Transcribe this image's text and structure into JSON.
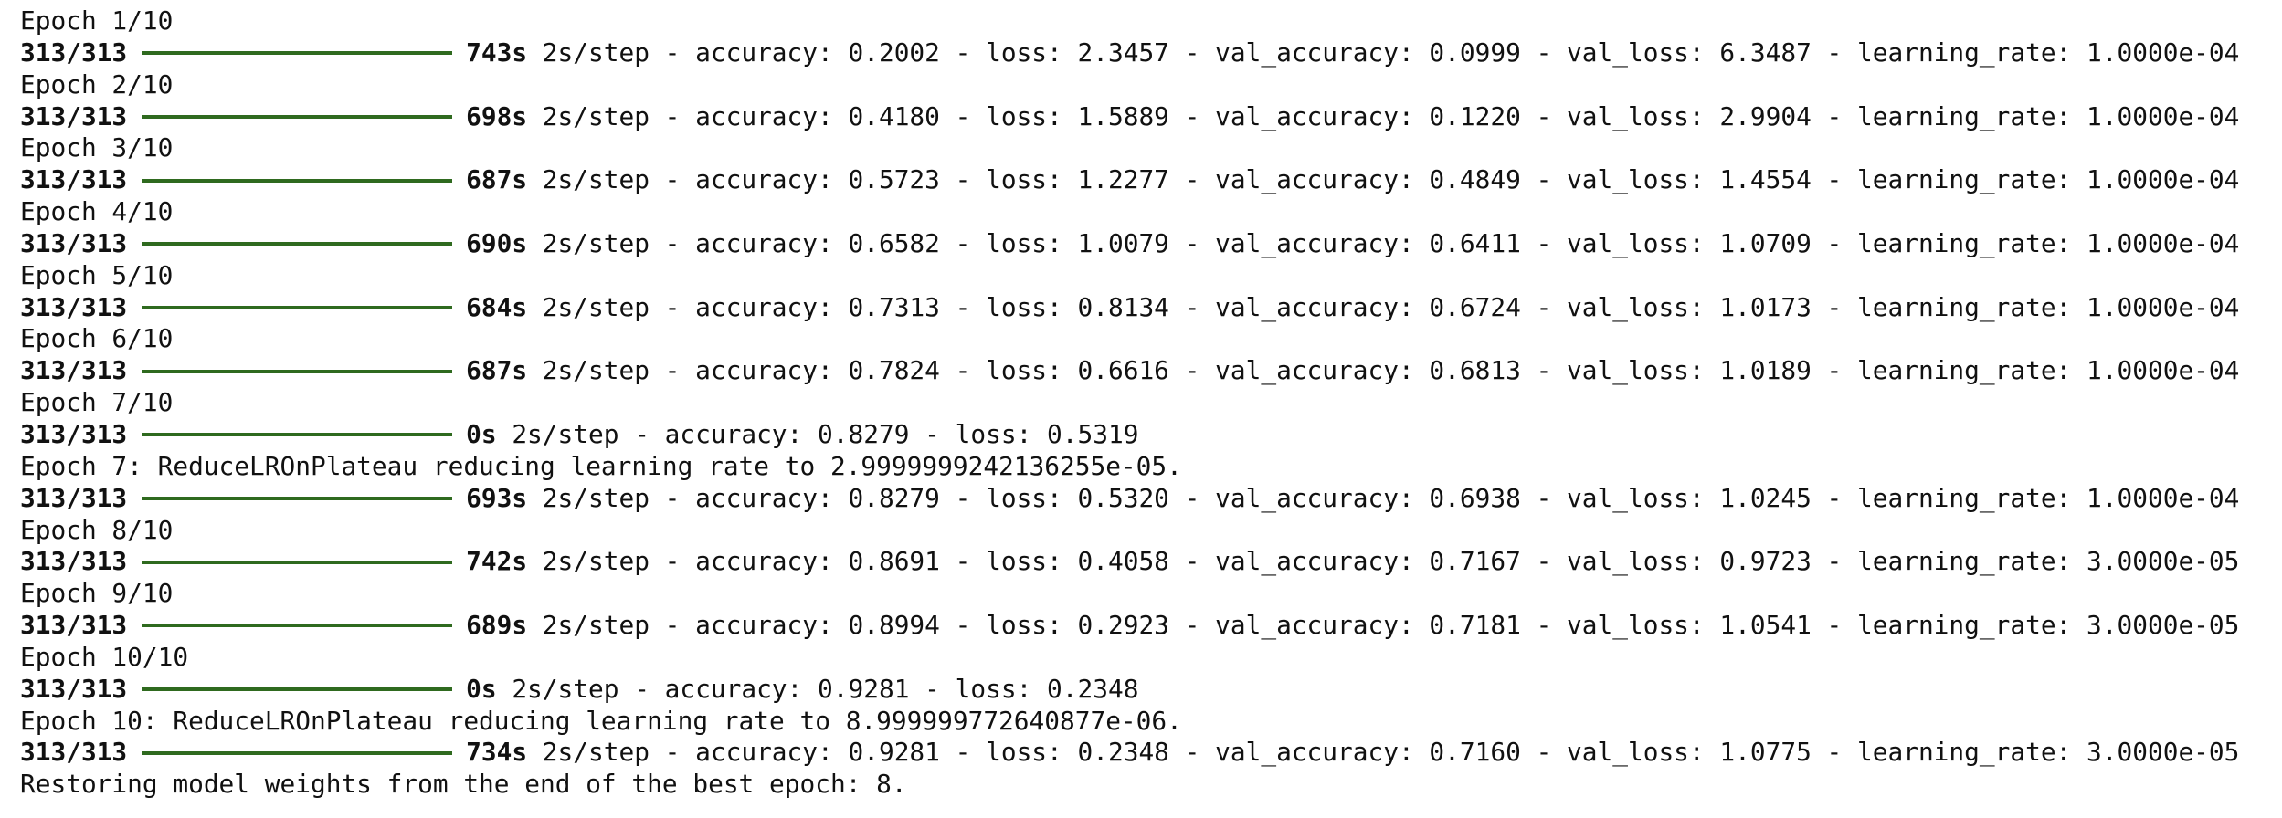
{
  "log": {
    "lines": [
      {
        "kind": "text",
        "text": "Epoch 1/10"
      },
      {
        "kind": "progress",
        "steps": "313/313",
        "progress": 1.0,
        "time": "743s",
        "rest": "2s/step - accuracy: 0.2002 - loss: 2.3457 - val_accuracy: 0.0999 - val_loss: 6.3487 - learning_rate: 1.0000e-04"
      },
      {
        "kind": "text",
        "text": "Epoch 2/10"
      },
      {
        "kind": "progress",
        "steps": "313/313",
        "progress": 1.0,
        "time": "698s",
        "rest": "2s/step - accuracy: 0.4180 - loss: 1.5889 - val_accuracy: 0.1220 - val_loss: 2.9904 - learning_rate: 1.0000e-04"
      },
      {
        "kind": "text",
        "text": "Epoch 3/10"
      },
      {
        "kind": "progress",
        "steps": "313/313",
        "progress": 1.0,
        "time": "687s",
        "rest": "2s/step - accuracy: 0.5723 - loss: 1.2277 - val_accuracy: 0.4849 - val_loss: 1.4554 - learning_rate: 1.0000e-04"
      },
      {
        "kind": "text",
        "text": "Epoch 4/10"
      },
      {
        "kind": "progress",
        "steps": "313/313",
        "progress": 1.0,
        "time": "690s",
        "rest": "2s/step - accuracy: 0.6582 - loss: 1.0079 - val_accuracy: 0.6411 - val_loss: 1.0709 - learning_rate: 1.0000e-04"
      },
      {
        "kind": "text",
        "text": "Epoch 5/10"
      },
      {
        "kind": "progress",
        "steps": "313/313",
        "progress": 1.0,
        "time": "684s",
        "rest": "2s/step - accuracy: 0.7313 - loss: 0.8134 - val_accuracy: 0.6724 - val_loss: 1.0173 - learning_rate: 1.0000e-04"
      },
      {
        "kind": "text",
        "text": "Epoch 6/10"
      },
      {
        "kind": "progress",
        "steps": "313/313",
        "progress": 1.0,
        "time": "687s",
        "rest": "2s/step - accuracy: 0.7824 - loss: 0.6616 - val_accuracy: 0.6813 - val_loss: 1.0189 - learning_rate: 1.0000e-04"
      },
      {
        "kind": "text",
        "text": "Epoch 7/10"
      },
      {
        "kind": "progress",
        "steps": "313/313",
        "progress": 1.0,
        "time": "0s",
        "rest": "2s/step - accuracy: 0.8279 - loss: 0.5319"
      },
      {
        "kind": "text",
        "text": "Epoch 7: ReduceLROnPlateau reducing learning rate to 2.9999999242136255e-05."
      },
      {
        "kind": "progress",
        "steps": "313/313",
        "progress": 1.0,
        "time": "693s",
        "rest": "2s/step - accuracy: 0.8279 - loss: 0.5320 - val_accuracy: 0.6938 - val_loss: 1.0245 - learning_rate: 1.0000e-04"
      },
      {
        "kind": "text",
        "text": "Epoch 8/10"
      },
      {
        "kind": "progress",
        "steps": "313/313",
        "progress": 1.0,
        "time": "742s",
        "rest": "2s/step - accuracy: 0.8691 - loss: 0.4058 - val_accuracy: 0.7167 - val_loss: 0.9723 - learning_rate: 3.0000e-05"
      },
      {
        "kind": "text",
        "text": "Epoch 9/10"
      },
      {
        "kind": "progress",
        "steps": "313/313",
        "progress": 1.0,
        "time": "689s",
        "rest": "2s/step - accuracy: 0.8994 - loss: 0.2923 - val_accuracy: 0.7181 - val_loss: 1.0541 - learning_rate: 3.0000e-05"
      },
      {
        "kind": "text",
        "text": "Epoch 10/10"
      },
      {
        "kind": "progress",
        "steps": "313/313",
        "progress": 1.0,
        "time": "0s",
        "rest": "2s/step - accuracy: 0.9281 - loss: 0.2348"
      },
      {
        "kind": "text",
        "text": "Epoch 10: ReduceLROnPlateau reducing learning rate to 8.999999772640877e-06."
      },
      {
        "kind": "progress",
        "steps": "313/313",
        "progress": 1.0,
        "time": "734s",
        "rest": "2s/step - accuracy: 0.9281 - loss: 0.2348 - val_accuracy: 0.7160 - val_loss: 1.0775 - learning_rate: 3.0000e-05"
      },
      {
        "kind": "text",
        "text": "Restoring model weights from the end of the best epoch: 8."
      }
    ]
  },
  "colors": {
    "text": "#111111",
    "progress_bar": "#2f6a1f",
    "background": "#ffffff"
  }
}
